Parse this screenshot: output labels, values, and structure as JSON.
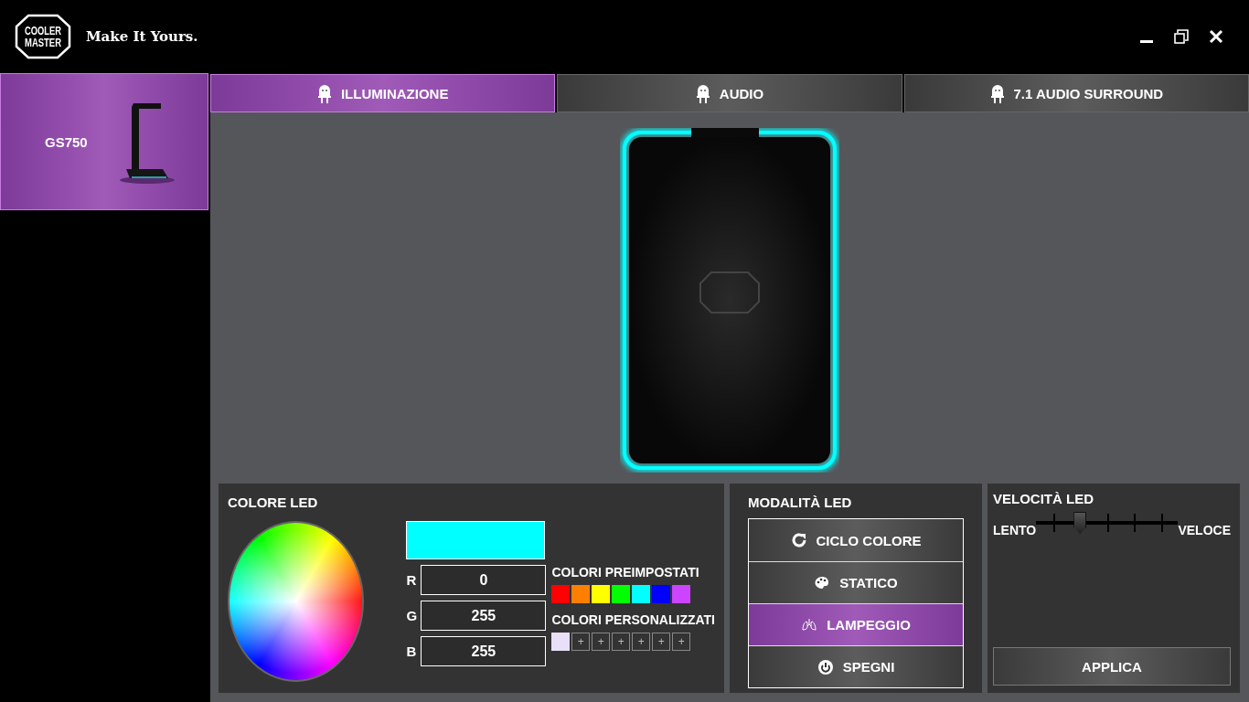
{
  "header": {
    "logo_text": [
      "COOLER",
      "MASTER"
    ],
    "tagline": "Make It Yours."
  },
  "devices": [
    {
      "name": "GS750",
      "selected": true
    }
  ],
  "tabs": [
    {
      "label": "ILLUMINAZIONE",
      "selected": true
    },
    {
      "label": "AUDIO",
      "selected": false
    },
    {
      "label": "7.1 AUDIO SURROUND",
      "selected": false
    }
  ],
  "preview": {
    "color": "#00ffff"
  },
  "led_color": {
    "title": "COLORE LED",
    "current": {
      "color": "#00ffff"
    },
    "fields": [
      {
        "label": "R",
        "value": "0"
      },
      {
        "label": "G",
        "value": "255"
      },
      {
        "label": "B",
        "value": "255"
      }
    ],
    "presets_title": "COLORI PREIMPOSTATI",
    "presets": [
      {
        "color": "#ff0000"
      },
      {
        "color": "#ff7f00"
      },
      {
        "color": "#ffff00"
      },
      {
        "color": "#00ff00"
      },
      {
        "color": "#00ffff"
      },
      {
        "color": "#0000ff"
      },
      {
        "color": "#cc44ff"
      }
    ],
    "custom_title": "COLORI PERSONALIZZATI",
    "custom": [
      {
        "kind": "color",
        "color": "#e8e0f8"
      },
      {
        "kind": "add",
        "label": "+"
      },
      {
        "kind": "add",
        "label": "+"
      },
      {
        "kind": "add",
        "label": "+"
      },
      {
        "kind": "add",
        "label": "+"
      },
      {
        "kind": "add",
        "label": "+"
      },
      {
        "kind": "add",
        "label": "+"
      }
    ]
  },
  "led_mode": {
    "title": "MODALITÀ LED",
    "modes": [
      {
        "kind": "cycle",
        "label": "CICLO COLORE",
        "selected": false
      },
      {
        "kind": "static",
        "label": "STATICO",
        "selected": false
      },
      {
        "kind": "breath",
        "label": "LAMPEGGIO",
        "selected": true
      },
      {
        "kind": "off",
        "label": "SPEGNI",
        "selected": false
      }
    ]
  },
  "led_speed": {
    "title": "VELOCITÀ LED",
    "min_label": "LENTO",
    "max_label": "VELOCE",
    "level": 0.31,
    "apply": "APPLICA"
  }
}
